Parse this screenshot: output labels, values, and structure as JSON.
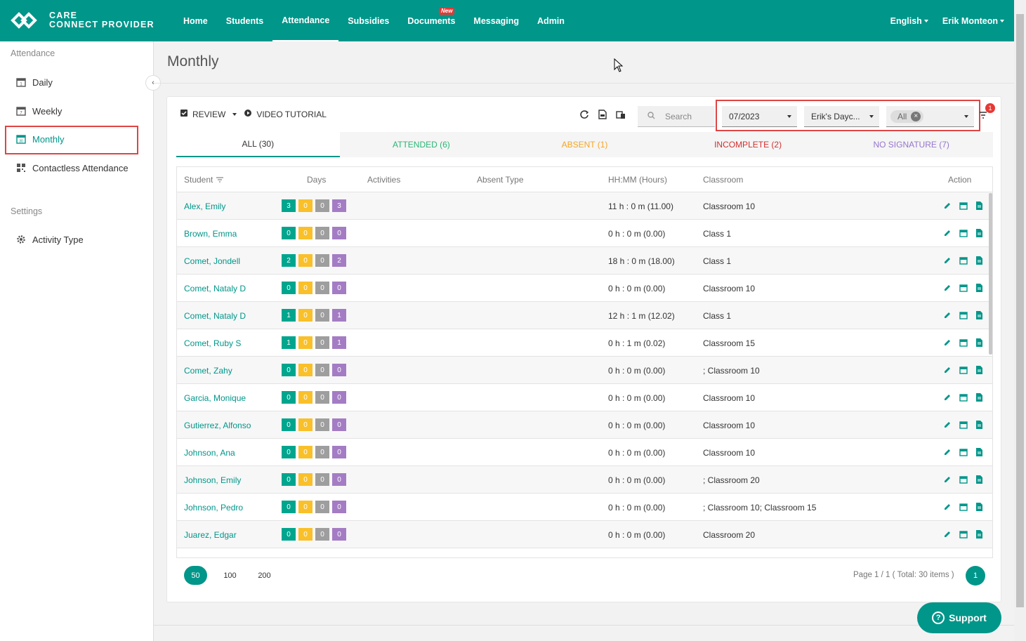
{
  "brand": {
    "line1": "CARE",
    "line2": "CONNECT PROVIDER"
  },
  "nav": [
    {
      "label": "Home"
    },
    {
      "label": "Students"
    },
    {
      "label": "Attendance"
    },
    {
      "label": "Subsidies"
    },
    {
      "label": "Documents",
      "badge": "New"
    },
    {
      "label": "Messaging"
    },
    {
      "label": "Admin"
    }
  ],
  "nav_active": "Attendance",
  "top_right": {
    "language": "English",
    "user": "Erik Monteon"
  },
  "sidebar": {
    "section_attendance": "Attendance",
    "items": [
      {
        "label": "Daily",
        "icon": "calendar-day-icon"
      },
      {
        "label": "Weekly",
        "icon": "calendar-week-icon"
      },
      {
        "label": "Monthly",
        "icon": "calendar-month-icon"
      },
      {
        "label": "Contactless Attendance",
        "icon": "qr-code-icon"
      }
    ],
    "section_settings": "Settings",
    "settings_items": [
      {
        "label": "Activity Type",
        "icon": "gear-icon"
      }
    ]
  },
  "page": {
    "title": "Monthly"
  },
  "toolbar": {
    "review_label": "REVIEW",
    "video_label": "VIDEO TUTORIAL",
    "search_placeholder": "Search",
    "month": "07/2023",
    "center": "Erik's Dayc...",
    "classroom_chip": "All",
    "filter_count": "1"
  },
  "tabs": [
    {
      "label": "ALL (30)"
    },
    {
      "label": "ATTENDED (6)"
    },
    {
      "label": "ABSENT (1)"
    },
    {
      "label": "INCOMPLETE (2)"
    },
    {
      "label": "NO SIGNATURE (7)"
    }
  ],
  "table": {
    "headers": {
      "student": "Student",
      "days": "Days",
      "activities": "Activities",
      "absent_type": "Absent Type",
      "hours": "HH:MM (Hours)",
      "classroom": "Classroom",
      "action": "Action"
    },
    "rows": [
      {
        "name": "Alex, Emily",
        "days": [
          "3",
          "0",
          "0",
          "3"
        ],
        "hours": "11 h : 0 m (11.00)",
        "classroom": "Classroom 10"
      },
      {
        "name": "Brown, Emma",
        "days": [
          "0",
          "0",
          "0",
          "0"
        ],
        "hours": "0 h : 0 m (0.00)",
        "classroom": "Class 1"
      },
      {
        "name": "Comet, Jondell",
        "days": [
          "2",
          "0",
          "0",
          "2"
        ],
        "hours": "18 h : 0 m (18.00)",
        "classroom": "Class 1"
      },
      {
        "name": "Comet, Nataly D",
        "days": [
          "0",
          "0",
          "0",
          "0"
        ],
        "hours": "0 h : 0 m (0.00)",
        "classroom": "Classroom 10"
      },
      {
        "name": "Comet, Nataly D",
        "days": [
          "1",
          "0",
          "0",
          "1"
        ],
        "hours": "12 h : 1 m (12.02)",
        "classroom": "Class 1"
      },
      {
        "name": "Comet, Ruby S",
        "days": [
          "1",
          "0",
          "0",
          "1"
        ],
        "hours": "0 h : 1 m (0.02)",
        "classroom": "Classroom 15"
      },
      {
        "name": "Comet, Zahy",
        "days": [
          "0",
          "0",
          "0",
          "0"
        ],
        "hours": "0 h : 0 m (0.00)",
        "classroom": "; Classroom 10"
      },
      {
        "name": "Garcia, Monique",
        "days": [
          "0",
          "0",
          "0",
          "0"
        ],
        "hours": "0 h : 0 m (0.00)",
        "classroom": "Classroom 10"
      },
      {
        "name": "Gutierrez, Alfonso",
        "days": [
          "0",
          "0",
          "0",
          "0"
        ],
        "hours": "0 h : 0 m (0.00)",
        "classroom": "Classroom 10"
      },
      {
        "name": "Johnson, Ana",
        "days": [
          "0",
          "0",
          "0",
          "0"
        ],
        "hours": "0 h : 0 m (0.00)",
        "classroom": "Classroom 10"
      },
      {
        "name": "Johnson, Emily",
        "days": [
          "0",
          "0",
          "0",
          "0"
        ],
        "hours": "0 h : 0 m (0.00)",
        "classroom": "; Classroom 20"
      },
      {
        "name": "Johnson, Pedro",
        "days": [
          "0",
          "0",
          "0",
          "0"
        ],
        "hours": "0 h : 0 m (0.00)",
        "classroom": "; Classroom 10; Classroom 15"
      },
      {
        "name": "Juarez, Edgar",
        "days": [
          "0",
          "0",
          "0",
          "0"
        ],
        "hours": "0 h : 0 m (0.00)",
        "classroom": "Classroom 20"
      }
    ]
  },
  "pager": {
    "sizes": [
      "50",
      "100",
      "200"
    ],
    "active_size": "50",
    "info": "Page 1 / 1 ( Total: 30 items )",
    "page": "1"
  },
  "support": {
    "label": "Support"
  },
  "colors": {
    "brand": "#00968a",
    "attended": "#2bb673",
    "absent": "#f5a623",
    "incomplete": "#d32f2f",
    "no_signature": "#9575cd"
  }
}
